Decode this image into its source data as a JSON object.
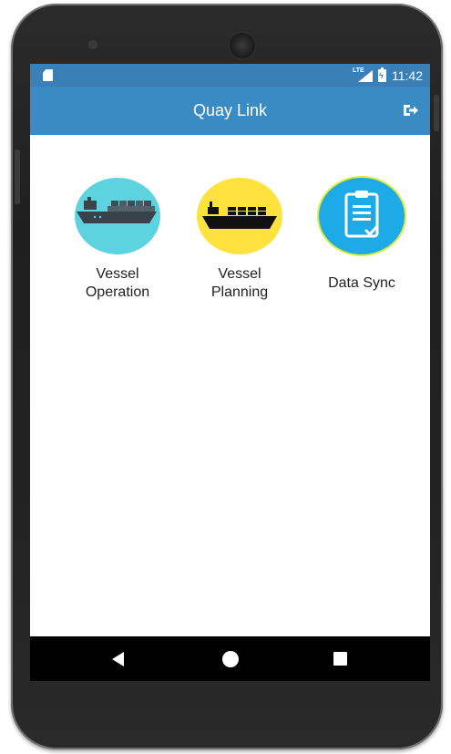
{
  "status_bar": {
    "network": "LTE",
    "time": "11:42",
    "battery_glyph": "ϟ",
    "background": "#3a80b6"
  },
  "app_bar": {
    "title": "Quay Link",
    "background": "#3a8bc4",
    "logout_icon": "logout-icon"
  },
  "menu": [
    {
      "label": "Vessel\nOperation",
      "icon": "container-ship-icon",
      "circle_color": "#5dd3df"
    },
    {
      "label": "Vessel\nPlanning",
      "icon": "cargo-ship-icon",
      "circle_color": "#ffe23d"
    },
    {
      "label": "Data Sync",
      "icon": "clipboard-check-icon",
      "circle_color": "#1ea9e7"
    }
  ],
  "nav_bar": {
    "back_icon": "back-triangle-icon",
    "home_icon": "home-circle-icon",
    "recents_icon": "recents-square-icon"
  }
}
